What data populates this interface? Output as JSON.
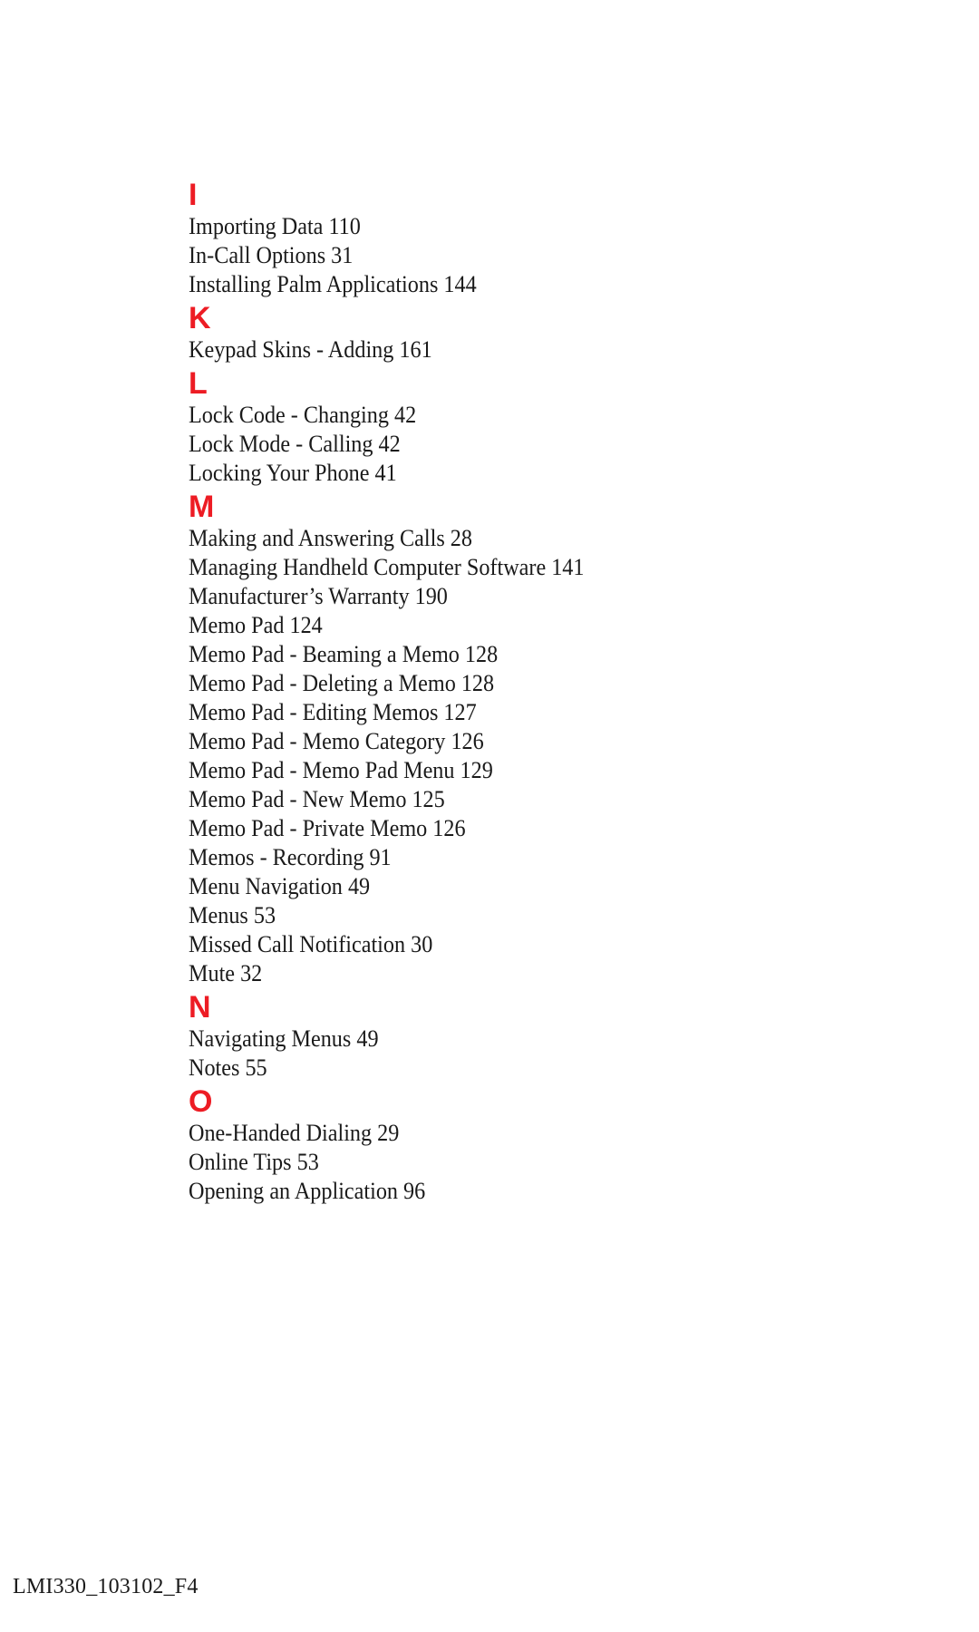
{
  "document": {
    "type": "book-index-page",
    "heading_color": "#ED1C24",
    "text_color": "#1a1a1a",
    "background_color": "#ffffff"
  },
  "index": {
    "groups": [
      {
        "letter": "I",
        "entries": [
          "Importing Data 110",
          "In-Call Options 31",
          "Installing Palm Applications 144"
        ]
      },
      {
        "letter": "K",
        "entries": [
          "Keypad Skins - Adding 161"
        ]
      },
      {
        "letter": "L",
        "entries": [
          "Lock Code - Changing 42",
          "Lock Mode - Calling 42",
          "Locking Your Phone 41"
        ]
      },
      {
        "letter": "M",
        "entries": [
          "Making and Answering Calls 28",
          "Managing Handheld Computer Software 141",
          "Manufacturer’s Warranty 190",
          "Memo Pad 124",
          "Memo Pad - Beaming a Memo 128",
          "Memo Pad - Deleting a Memo 128",
          "Memo Pad - Editing Memos 127",
          "Memo Pad - Memo Category 126",
          "Memo Pad - Memo Pad Menu 129",
          "Memo Pad - New Memo 125",
          "Memo Pad - Private Memo 126",
          "Memos - Recording 91",
          "Menu Navigation 49",
          "Menus 53",
          "Missed Call Notification 30",
          "Mute 32"
        ]
      },
      {
        "letter": "N",
        "entries": [
          "Navigating Menus 49",
          "Notes 55"
        ]
      },
      {
        "letter": "O",
        "entries": [
          "One-Handed Dialing 29",
          "Online Tips 53",
          "Opening an Application 96"
        ]
      }
    ]
  },
  "footer": {
    "document_code": "LMI330_103102_F4"
  }
}
